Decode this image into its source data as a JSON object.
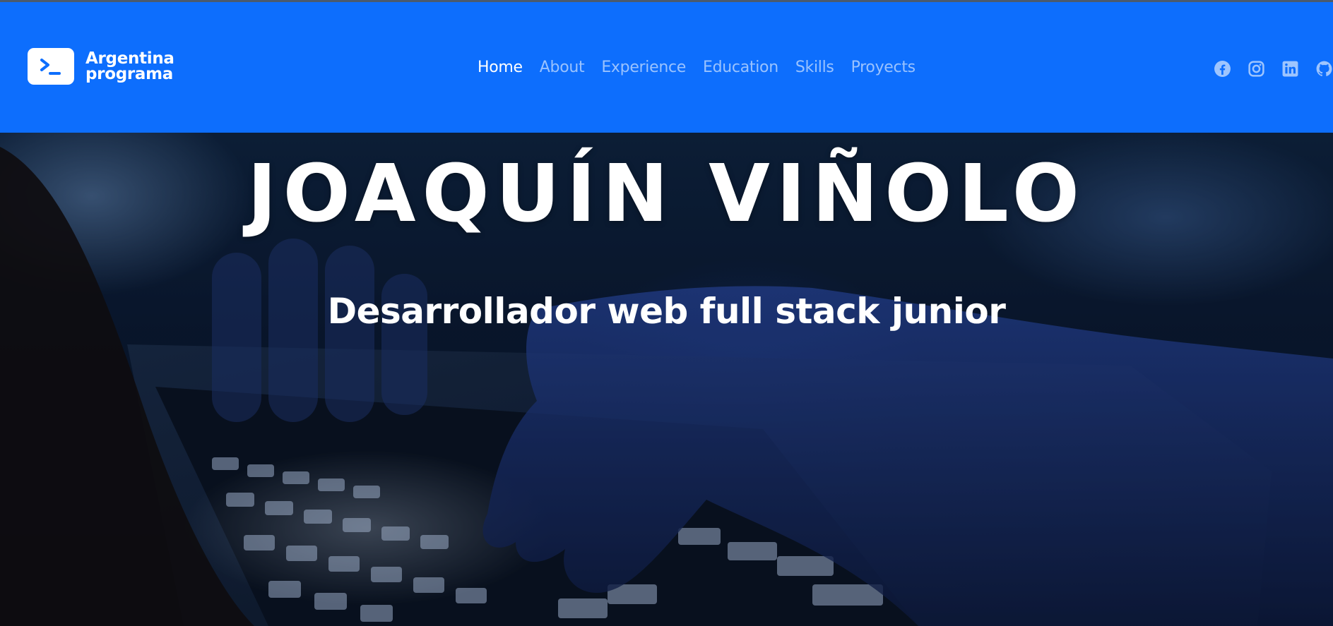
{
  "brand": {
    "line1": "Argentina",
    "line2": "programa",
    "icon": "terminal-icon"
  },
  "nav": {
    "items": [
      {
        "label": "Home",
        "active": true
      },
      {
        "label": "About",
        "active": false
      },
      {
        "label": "Experience",
        "active": false
      },
      {
        "label": "Education",
        "active": false
      },
      {
        "label": "Skills",
        "active": false
      },
      {
        "label": "Proyects",
        "active": false
      }
    ]
  },
  "socials": [
    {
      "icon": "facebook-icon"
    },
    {
      "icon": "instagram-icon"
    },
    {
      "icon": "linkedin-icon"
    },
    {
      "icon": "github-icon"
    }
  ],
  "hero": {
    "title": "JOAQUÍN VIÑOLO",
    "subtitle": "Desarrollador web full stack junior",
    "background_image": "hands typing on backlit laptop keyboard"
  },
  "colors": {
    "navbar": "#0d6efd",
    "nav_inactive": "rgba(255,255,255,0.58)",
    "nav_active": "#ffffff"
  }
}
